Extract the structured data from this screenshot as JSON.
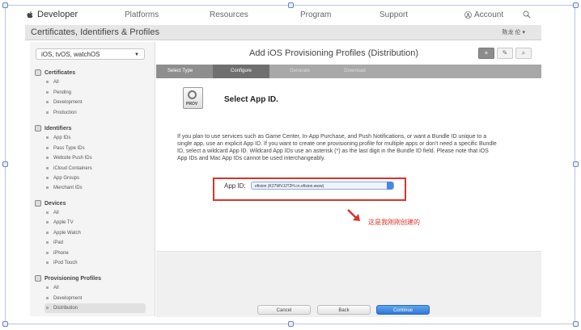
{
  "topnav": {
    "brand": "Developer",
    "links": [
      "Platforms",
      "Resources",
      "Program",
      "Support"
    ],
    "account": "Account"
  },
  "header": {
    "title": "Certificates, Identifiers & Profiles",
    "user": "陈龙 伦 ▾"
  },
  "sidebar": {
    "platform": "iOS, tvOS, watchOS",
    "sections": [
      {
        "title": "Certificates",
        "items": [
          "All",
          "Pending",
          "Development",
          "Production"
        ]
      },
      {
        "title": "Identifiers",
        "items": [
          "App IDs",
          "Pass Type IDs",
          "Website Push IDs",
          "iCloud Containers",
          "App Groups",
          "Merchant IDs"
        ]
      },
      {
        "title": "Devices",
        "items": [
          "All",
          "Apple TV",
          "Apple Watch",
          "iPad",
          "iPhone",
          "iPod Touch"
        ]
      },
      {
        "title": "Provisioning Profiles",
        "items": [
          "All",
          "Development",
          "Distribution"
        ]
      }
    ]
  },
  "main": {
    "title": "Add iOS Provisioning Profiles (Distribution)",
    "toolbar": {
      "add": "+",
      "edit": "✎",
      "search": "⌕"
    },
    "steps": [
      "Select Type",
      "Configure",
      "Generate",
      "Download"
    ],
    "icon_label": "PROV",
    "section_title": "Select App ID.",
    "description": "If you plan to use services such as Game Center, In-App Purchase, and Push Notifications, or want a Bundle ID unique to a single app, use an explicit App ID. If you want to create one provisioning profile for multiple apps or don't need a specific Bundle ID, select a wildcard App ID. Wildcard App IDs use an asterisk (*) as the last digit in the Bundle ID field. Please note that iOS App IDs and Mac App IDs cannot be used interchangeably.",
    "appid_label": "App ID:",
    "appid_value": "efision (K27WVJJT2H.cn.efision.www)",
    "annotation": "这是我刚刚创建的",
    "buttons": {
      "cancel": "Cancel",
      "back": "Back",
      "continue": "Continue"
    }
  },
  "colors": {
    "highlight": "#d8352a",
    "primary": "#2f79d8"
  }
}
